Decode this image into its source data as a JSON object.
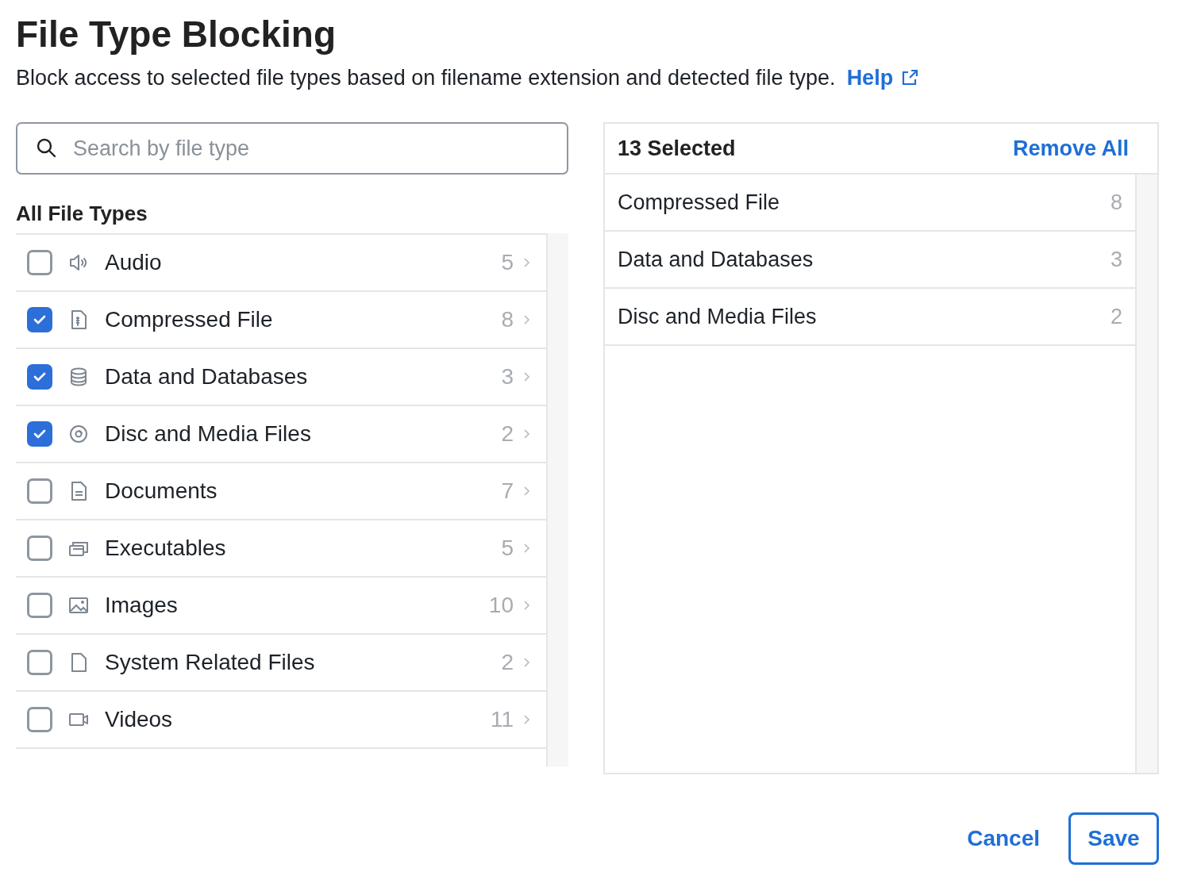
{
  "title": "File Type Blocking",
  "description": "Block access to selected file types based on filename extension and detected file type.",
  "help_link": "Help",
  "search": {
    "placeholder": "Search by file type"
  },
  "list_heading": "All File Types",
  "file_types": [
    {
      "kind": "audio",
      "label": "Audio",
      "count": "5",
      "checked": false
    },
    {
      "kind": "archive",
      "label": "Compressed File",
      "count": "8",
      "checked": true
    },
    {
      "kind": "database",
      "label": "Data and Databases",
      "count": "3",
      "checked": true
    },
    {
      "kind": "disc",
      "label": "Disc and Media Files",
      "count": "2",
      "checked": true
    },
    {
      "kind": "document",
      "label": "Documents",
      "count": "7",
      "checked": false
    },
    {
      "kind": "windows",
      "label": "Executables",
      "count": "5",
      "checked": false
    },
    {
      "kind": "image",
      "label": "Images",
      "count": "10",
      "checked": false
    },
    {
      "kind": "file",
      "label": "System Related Files",
      "count": "2",
      "checked": false
    },
    {
      "kind": "video",
      "label": "Videos",
      "count": "11",
      "checked": false
    }
  ],
  "selected_panel": {
    "count_label": "13 Selected",
    "remove_all": "Remove All",
    "items": [
      {
        "label": "Compressed File",
        "count": "8"
      },
      {
        "label": "Data and Databases",
        "count": "3"
      },
      {
        "label": "Disc and Media Files",
        "count": "2"
      }
    ]
  },
  "buttons": {
    "cancel": "Cancel",
    "save": "Save"
  }
}
